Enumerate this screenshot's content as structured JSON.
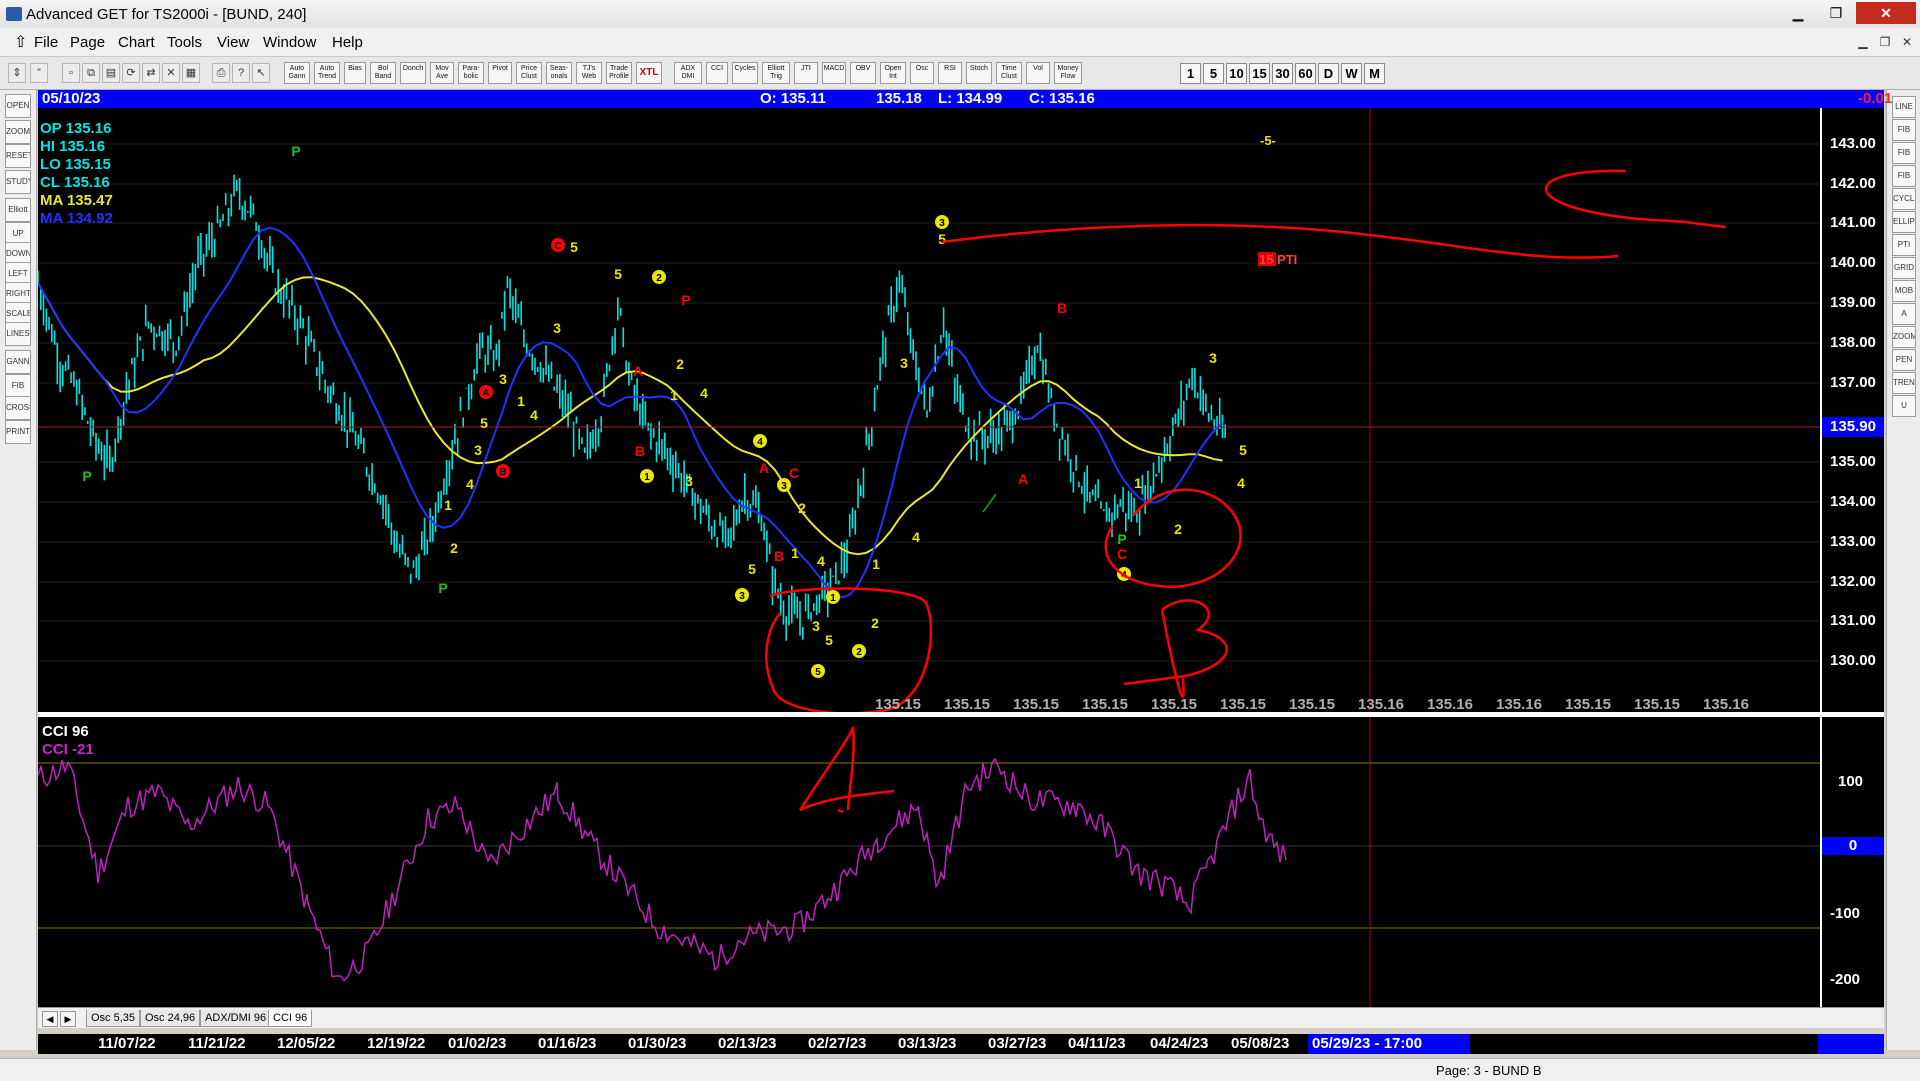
{
  "window": {
    "title": "Advanced GET for TS2000i - [BUND, 240]",
    "controls": {
      "minimize": "▁",
      "maximize": "❐",
      "close": "✕"
    }
  },
  "menu": {
    "items": [
      "File",
      "Page",
      "Chart",
      "Tools",
      "View",
      "Window",
      "Help"
    ],
    "mdi_controls": [
      "▁",
      "❐",
      "✕"
    ]
  },
  "toolbar": {
    "study_buttons": [
      "Auto Gann",
      "Auto Trend",
      "Bias",
      "Bol Band",
      "Donch",
      "Mov Ave",
      "Para- bolic",
      "Pivot",
      "Price Clust",
      "Seas- onals",
      "TJ's Web",
      "Trade Profile",
      "XTL",
      "ADX DMI",
      "CCI",
      "Cycles",
      "Elliott Trig",
      "JTI",
      "MACD",
      "OBV",
      "Open Int",
      "Osc",
      "RSI",
      "Stoch",
      "Time Clust",
      "Vol",
      "Money Flow"
    ],
    "periods": [
      "1",
      "5",
      "10",
      "15",
      "30",
      "60",
      "D",
      "W",
      "M"
    ]
  },
  "left_palette": [
    "OPEN",
    "ZOOM",
    "RESET",
    "STUDY",
    "Elliott",
    "UP",
    "DOWN",
    "LEFT",
    "RIGHT",
    "SCALE",
    "LINES",
    "GANN",
    "FIB",
    "CROSS",
    "PRINT"
  ],
  "right_palette": [
    "LINE",
    "FIB RET",
    "FIB EXT",
    "FIB TIME",
    "CYCLE",
    "ELLIPS",
    "PTI",
    "GRID",
    "MOB",
    "A",
    "ZOOM",
    "PEN",
    "TREND",
    "U"
  ],
  "header": {
    "date": "05/10/23",
    "open": "O: 135.11",
    "high": "135.18",
    "low": "L: 134.99",
    "close": "C: 135.16",
    "change": "-0.01"
  },
  "legend": {
    "op": "OP  135.16",
    "hi": "HI   135.16",
    "lo": "LO  135.15",
    "cl": "CL  135.16",
    "ma1": "MA  135.47",
    "ma2": "MA  134.92"
  },
  "osc_legend": {
    "title": "CCI 96",
    "value": "CCI  -21"
  },
  "price_axis": {
    "ticks": [
      "143.00",
      "142.00",
      "141.00",
      "140.00",
      "139.00",
      "138.00",
      "137.00",
      "135.00",
      "134.00",
      "133.00",
      "132.00",
      "131.00",
      "130.00"
    ],
    "last": "135.90"
  },
  "osc_axis": {
    "ticks": [
      "100",
      "-100",
      "-200"
    ],
    "zero": "0"
  },
  "projection_row": [
    "135.15",
    "135.15",
    "135.15",
    "135.15",
    "135.15",
    "135.15",
    "135.15",
    "135.16",
    "135.16",
    "135.16",
    "135.15",
    "135.15",
    "135.16"
  ],
  "labels": {
    "wave_count": "-5-",
    "pti": "15 PTI",
    "handwritten_a": "A",
    "handwritten_b": "B"
  },
  "tabs": [
    "Osc 5,35",
    "Osc 24,96",
    "ADX/DMI 96",
    "CCI 96"
  ],
  "dates": [
    "11/07/22",
    "11/21/22",
    "12/05/22",
    "12/19/22",
    "01/02/23",
    "01/16/23",
    "01/30/23",
    "02/13/23",
    "02/27/23",
    "03/13/23",
    "03/27/23",
    "04/11/23",
    "04/24/23",
    "05/08/23",
    "05/29/23 - 17:00"
  ],
  "status": "Page: 3 - BUND B",
  "colors": {
    "price_bars": "#00e5e5",
    "ma_yellow": "#e8e830",
    "ma_blue": "#2430ff",
    "cci": "#c020c0",
    "annotation": "#ff0000",
    "header_bg": "#0000ff"
  }
}
